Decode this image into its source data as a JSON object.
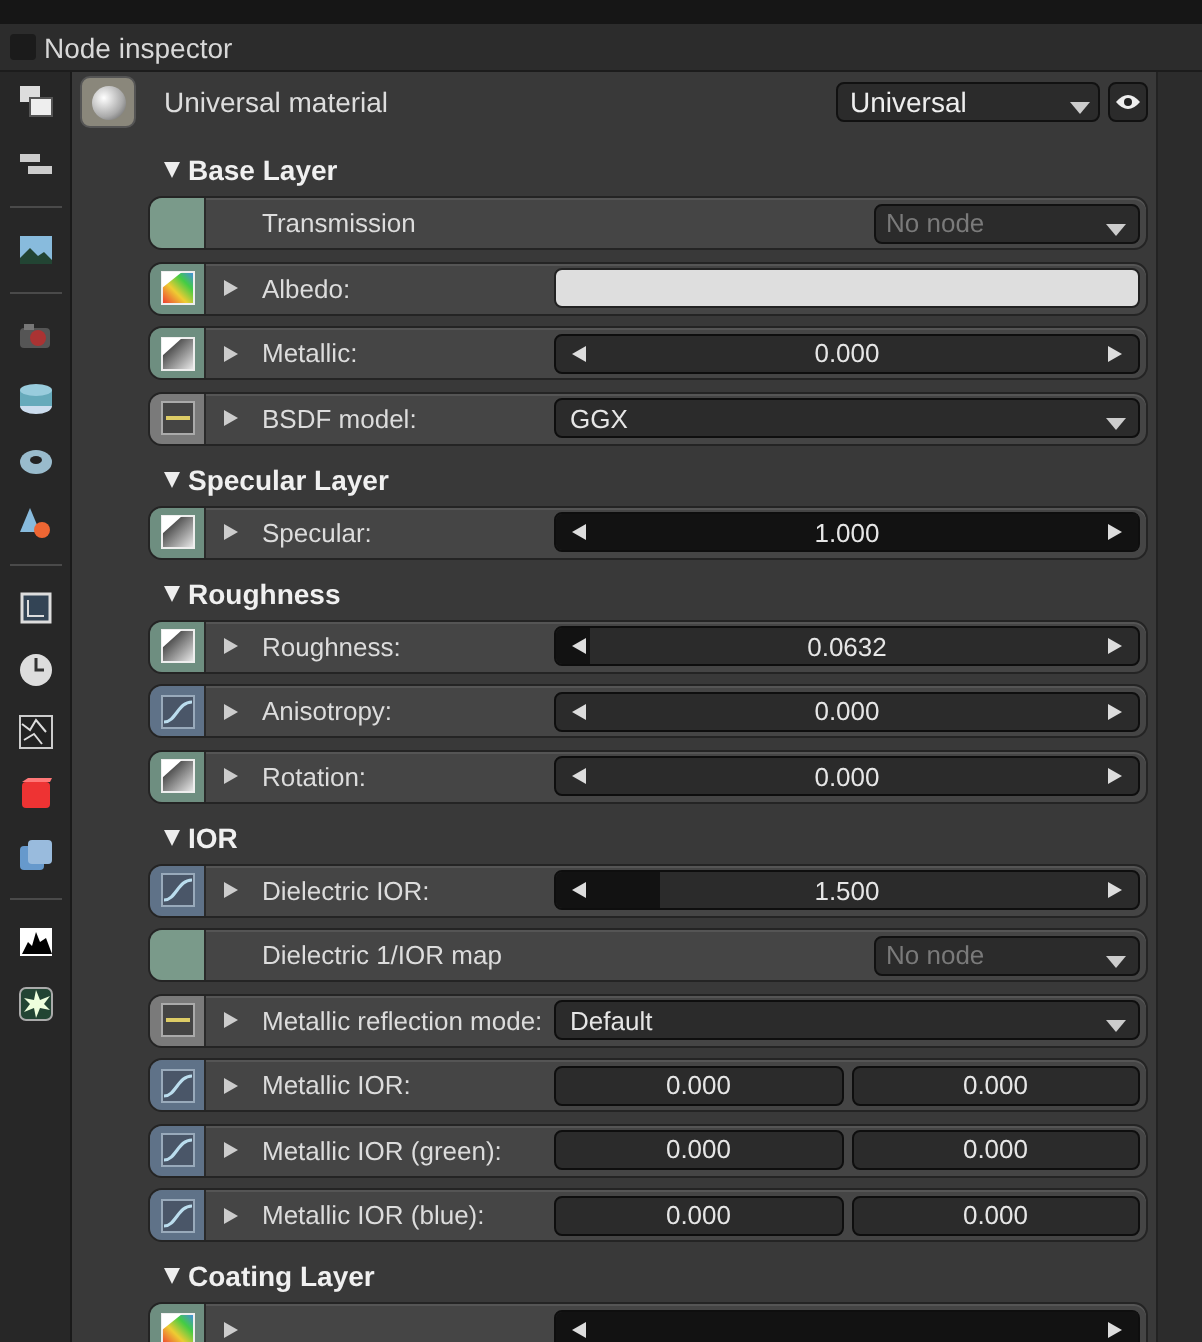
{
  "window": {
    "title": "Node inspector",
    "checked": false
  },
  "node": {
    "name": "Universal material",
    "type": "Universal"
  },
  "sections": [
    {
      "title": "Base Layer",
      "expanded": true,
      "rows": [
        {
          "kind": "pin",
          "pin": {
            "kind": "node"
          },
          "label": "Transmission",
          "value": "No node",
          "disabled": true
        },
        {
          "kind": "color",
          "pin": {
            "kind": "texture"
          },
          "label": "Albedo:",
          "color": "#dedede"
        },
        {
          "kind": "slider",
          "pin": {
            "kind": "float"
          },
          "label": "Metallic:",
          "value": "0.000",
          "level": 0
        },
        {
          "kind": "enum",
          "pin": {
            "kind": "enum"
          },
          "label": "BSDF model:",
          "value": "GGX"
        }
      ]
    },
    {
      "title": "Specular Layer",
      "expanded": true,
      "rows": [
        {
          "kind": "slider",
          "pin": {
            "kind": "float"
          },
          "label": "Specular:",
          "value": "1.000",
          "level": 1
        }
      ]
    },
    {
      "title": "Roughness",
      "expanded": true,
      "rows": [
        {
          "kind": "slider",
          "pin": {
            "kind": "float"
          },
          "label": "Roughness:",
          "value": "0.0632",
          "level": 0.06
        },
        {
          "kind": "slider",
          "pin": {
            "kind": "curve"
          },
          "label": "Anisotropy:",
          "value": "0.000",
          "level": 0
        },
        {
          "kind": "slider",
          "pin": {
            "kind": "float"
          },
          "label": "Rotation:",
          "value": "0.000",
          "level": 0
        }
      ]
    },
    {
      "title": "IOR",
      "expanded": true,
      "rows": [
        {
          "kind": "slider",
          "pin": {
            "kind": "curve"
          },
          "label": "Dielectric IOR:",
          "value": "1.500",
          "level": 0.18
        },
        {
          "kind": "pin",
          "pin": {
            "kind": "node"
          },
          "label": "Dielectric 1/IOR map",
          "value": "No node",
          "disabled": true
        },
        {
          "kind": "enum",
          "pin": {
            "kind": "enum"
          },
          "label": "Metallic reflection mode:",
          "value": "Default"
        },
        {
          "kind": "pair",
          "pin": {
            "kind": "curve"
          },
          "label": "Metallic IOR:",
          "values": [
            "0.000",
            "0.000"
          ]
        },
        {
          "kind": "pair",
          "pin": {
            "kind": "curve"
          },
          "label": "Metallic IOR (green):",
          "values": [
            "0.000",
            "0.000"
          ]
        },
        {
          "kind": "pair",
          "pin": {
            "kind": "curve"
          },
          "label": "Metallic IOR (blue):",
          "values": [
            "0.000",
            "0.000"
          ]
        }
      ]
    },
    {
      "title": "Coating Layer",
      "expanded": true,
      "rows": [
        {
          "kind": "slider",
          "pin": {
            "kind": "texture"
          },
          "level": 1
        }
      ]
    }
  ]
}
